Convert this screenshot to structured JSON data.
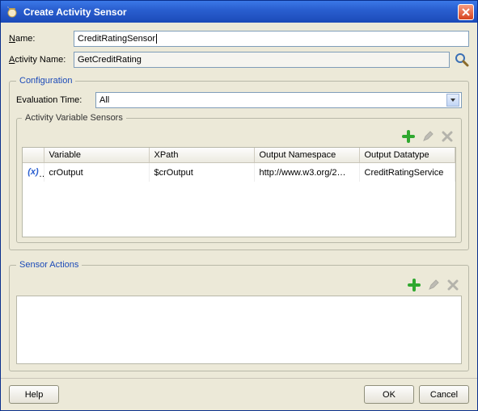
{
  "window": {
    "title": "Create Activity Sensor"
  },
  "form": {
    "name_label": "Name:",
    "name_value": "CreditRatingSensor",
    "activity_label": "Activity Name:",
    "activity_value": "GetCreditRating"
  },
  "config": {
    "legend": "Configuration",
    "eval_label": "Evaluation Time:",
    "eval_value": "All",
    "vars_legend": "Activity Variable Sensors",
    "columns": {
      "c0": "",
      "c1": "Variable",
      "c2": "XPath",
      "c3": "Output Namespace",
      "c4": "Output Datatype"
    },
    "rows": [
      {
        "variable": "crOutput",
        "xpath": "$crOutput",
        "ns": "http://www.w3.org/2…",
        "dtype": "CreditRatingService"
      }
    ]
  },
  "actions": {
    "legend": "Sensor Actions"
  },
  "buttons": {
    "help": "Help",
    "ok": "OK",
    "cancel": "Cancel"
  }
}
